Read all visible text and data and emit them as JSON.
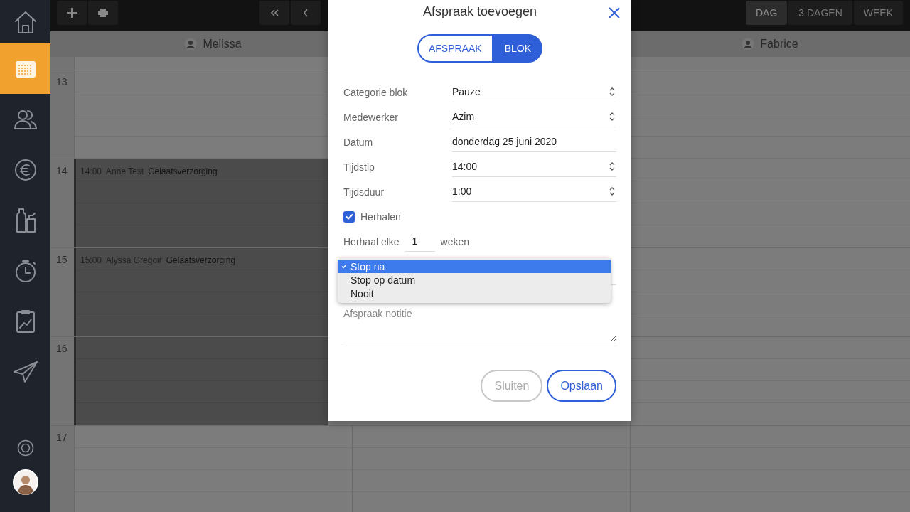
{
  "sidebar": {
    "items": [
      {
        "kind": "home",
        "selected": false
      },
      {
        "kind": "calendar",
        "selected": true
      },
      {
        "kind": "clients",
        "selected": false
      },
      {
        "kind": "money",
        "selected": false
      },
      {
        "kind": "products",
        "selected": false
      },
      {
        "kind": "timer",
        "selected": false
      },
      {
        "kind": "reports",
        "selected": false
      },
      {
        "kind": "send",
        "selected": false
      }
    ],
    "footer": [
      {
        "kind": "help"
      },
      {
        "kind": "avatar"
      }
    ]
  },
  "toolbar": {
    "actions": [
      {
        "kind": "add"
      },
      {
        "kind": "print"
      }
    ],
    "navigation": [
      {
        "kind": "first"
      },
      {
        "kind": "previous"
      }
    ],
    "views": [
      {
        "label": "DAG",
        "selected": true
      },
      {
        "label": "3 DAGEN",
        "selected": false
      },
      {
        "label": "WEEK",
        "selected": false
      }
    ]
  },
  "calendar": {
    "columns": [
      {
        "kind": "staff",
        "name": "Melissa"
      },
      {
        "kind": "hidden"
      },
      {
        "kind": "staff",
        "name": "Fabrice"
      }
    ],
    "rows": [
      {
        "hour": "13"
      },
      {
        "hour": "14",
        "appointment": {
          "time": "14:00",
          "client": "Anne Test",
          "service": "Gelaatsverzorging"
        }
      },
      {
        "hour": "15",
        "appointment": {
          "time": "15:00",
          "client": "Alyssa Gregoir",
          "service": "Gelaatsverzorging"
        }
      },
      {
        "hour": "16",
        "continued": true
      },
      {
        "hour": "17"
      }
    ]
  },
  "dialog": {
    "title": "Afspraak toevoegen",
    "segments": [
      {
        "label": "AFSPRAAK",
        "selected": false
      },
      {
        "label": "BLOK",
        "selected": true
      }
    ],
    "fields": [
      {
        "label": "Categorie blok",
        "value": "Pauze",
        "kind": "select"
      },
      {
        "label": "Medewerker",
        "value": "Azim",
        "kind": "select"
      },
      {
        "label": "Datum",
        "value": "donderdag 25 juni 2020",
        "kind": "text"
      },
      {
        "label": "Tijdstip",
        "value": "14:00",
        "kind": "select"
      },
      {
        "label": "Tijdsduur",
        "value": "1:00",
        "kind": "select"
      }
    ],
    "repeat": {
      "label": "Herhalen",
      "checked": true
    },
    "interval": {
      "label": "Herhaal elke",
      "value": "1",
      "unit": "weken"
    },
    "end": {
      "expanded": true,
      "options": [
        {
          "label": "Stop na",
          "selected": true
        },
        {
          "label": "Stop op datum",
          "selected": false
        },
        {
          "label": "Nooit",
          "selected": false
        }
      ]
    },
    "note": {
      "placeholder": "Afspraak notitie"
    },
    "buttons": [
      {
        "label": "Sluiten",
        "kind": "secondary"
      },
      {
        "label": "Opslaan",
        "kind": "primary"
      }
    ]
  }
}
